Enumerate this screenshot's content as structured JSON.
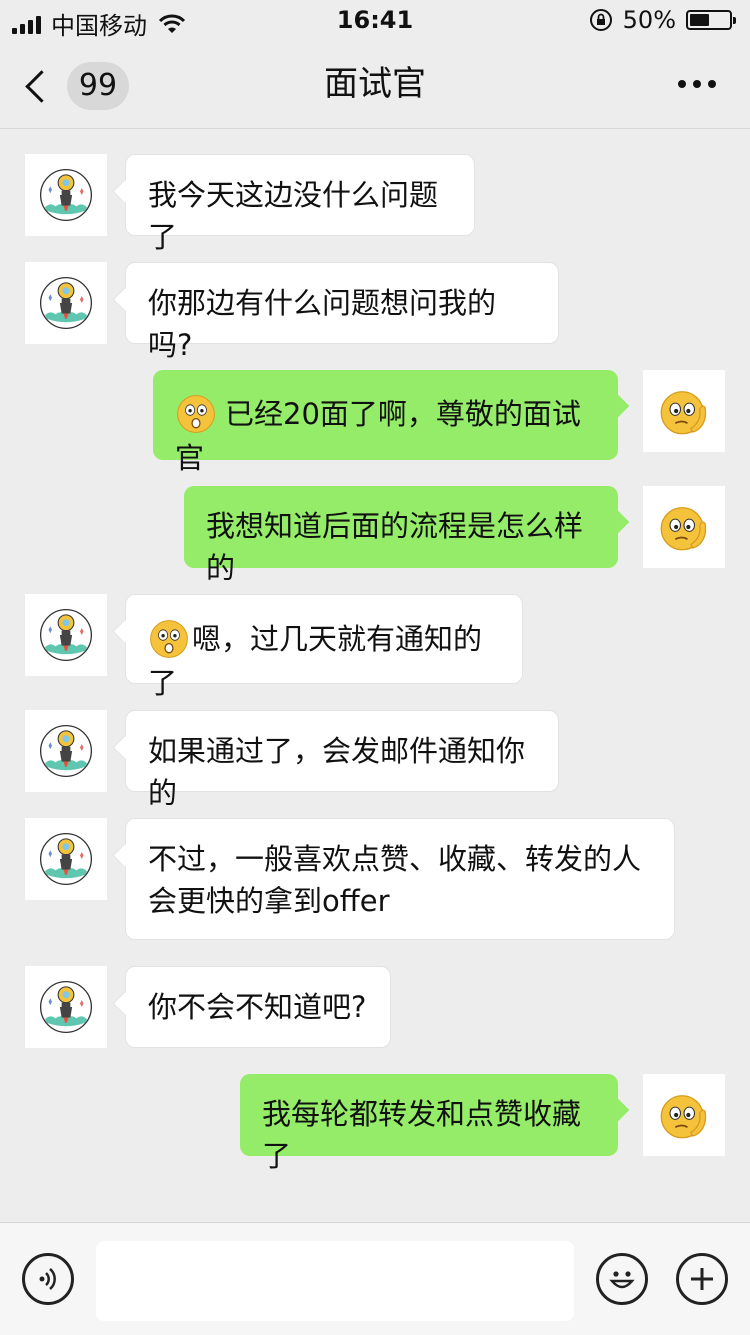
{
  "status_bar": {
    "carrier": "中国移动",
    "time": "16:41",
    "battery": "50%",
    "battery_level": 0.5
  },
  "header": {
    "unread_count": "99",
    "title": "面试官"
  },
  "messages": [
    {
      "side": "left",
      "text": "我今天这边没什么问题了"
    },
    {
      "side": "left",
      "text": "你那边有什么问题想问我的吗?"
    },
    {
      "side": "right",
      "emoji": "shocked-face-icon",
      "text": "已经20面了啊，尊敬的面试官"
    },
    {
      "side": "right",
      "text": "我想知道后面的流程是怎么样的"
    },
    {
      "side": "left",
      "emoji": "shocked-face-icon",
      "text": "嗯，过几天就有通知的了"
    },
    {
      "side": "left",
      "text": "如果通过了，会发邮件通知你的"
    },
    {
      "side": "left",
      "text": "不过，一般喜欢点赞、收藏、转发的人会更快的拿到offer"
    },
    {
      "side": "left",
      "text": "你不会不知道吧?"
    },
    {
      "side": "right",
      "text": "我每轮都转发和点赞收藏了"
    }
  ],
  "input": {
    "placeholder": ""
  },
  "icons": {
    "voice": "voice-icon",
    "emoji": "emoji-icon",
    "add": "plus-icon"
  }
}
